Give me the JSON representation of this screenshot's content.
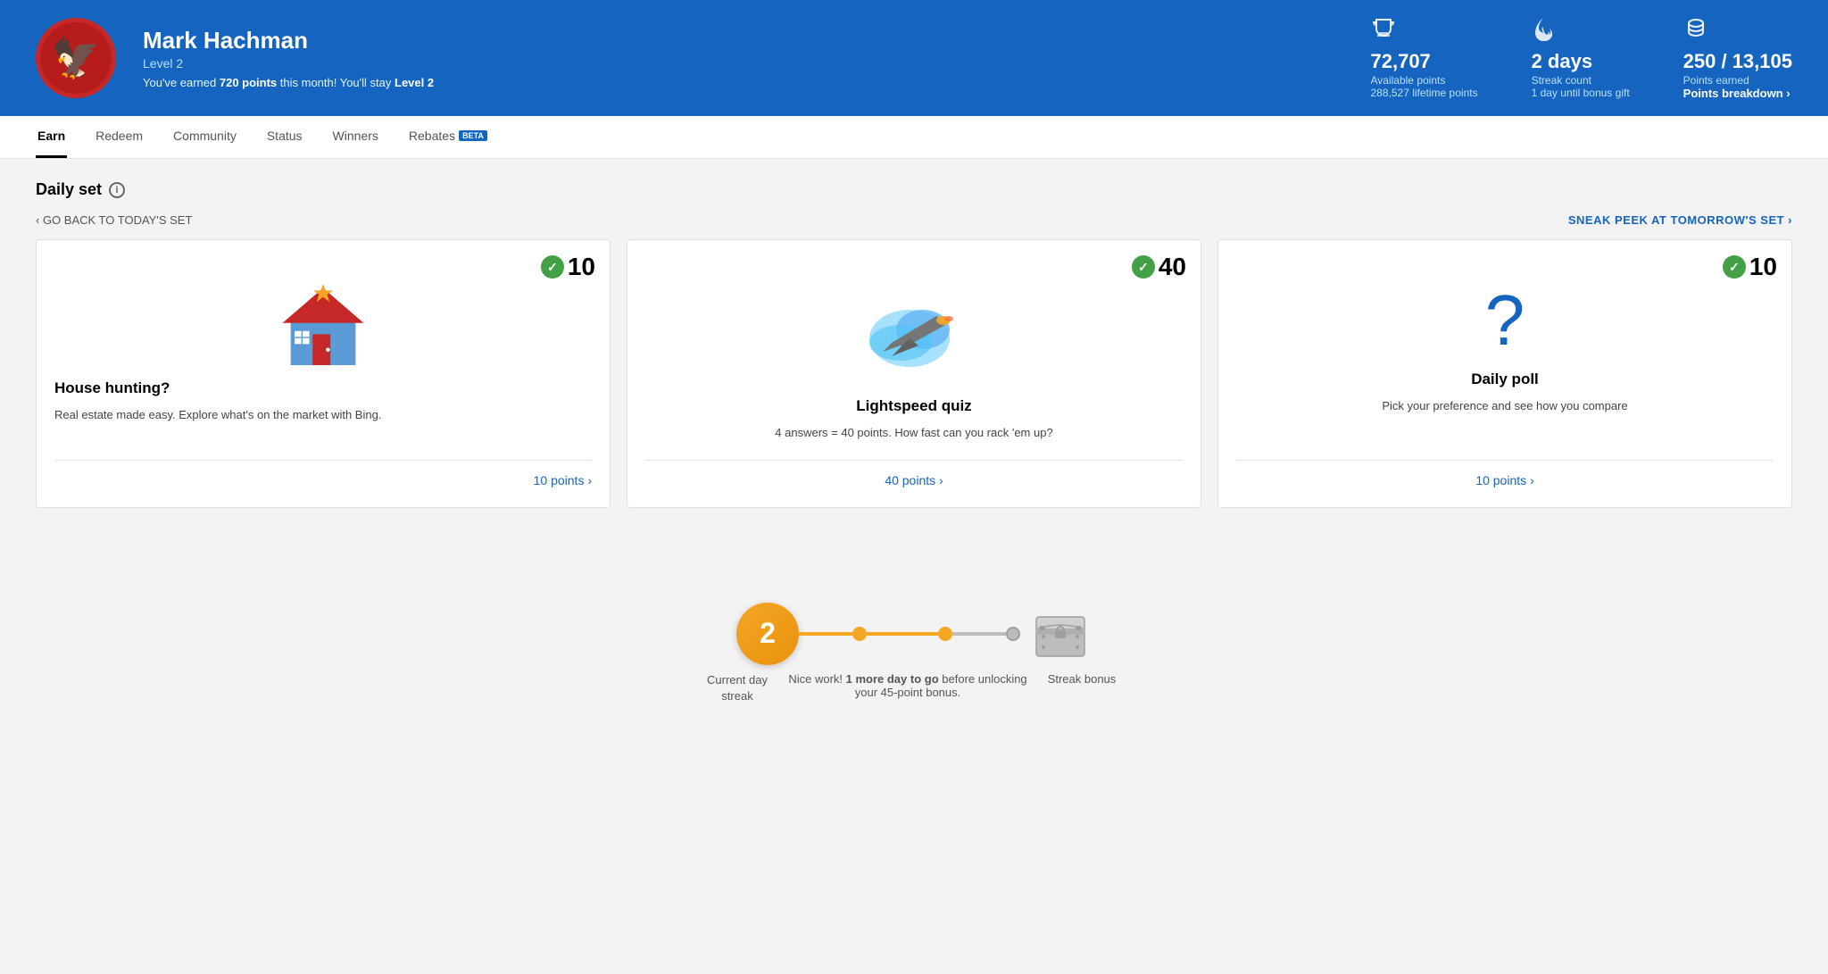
{
  "header": {
    "user_name": "Mark Hachman",
    "user_level": "Level 2",
    "user_msg_prefix": "You've earned ",
    "user_msg_points": "720 points",
    "user_msg_suffix": " this month! You'll stay ",
    "user_msg_level": "Level 2",
    "stats": [
      {
        "id": "available-points",
        "icon": "🏆",
        "main": "72,707",
        "label": "Available points",
        "sub": "288,527 lifetime points"
      },
      {
        "id": "streak",
        "icon": "🔥",
        "main": "2 days",
        "label": "Streak count",
        "sub": "1 day until bonus gift"
      },
      {
        "id": "points-earned",
        "icon": "💰",
        "main": "250 / 13,105",
        "label": "Points earned",
        "link": "Points breakdown ›"
      }
    ]
  },
  "nav": {
    "items": [
      {
        "id": "earn",
        "label": "Earn",
        "active": true
      },
      {
        "id": "redeem",
        "label": "Redeem",
        "active": false
      },
      {
        "id": "community",
        "label": "Community",
        "active": false
      },
      {
        "id": "status",
        "label": "Status",
        "active": false
      },
      {
        "id": "winners",
        "label": "Winners",
        "active": false
      },
      {
        "id": "rebates",
        "label": "Rebates",
        "active": false,
        "badge": "BETA"
      }
    ]
  },
  "main": {
    "section_title": "Daily set",
    "back_label": "‹ GO BACK TO TODAY'S SET",
    "forward_label": "SNEAK PEEK AT TOMORROW'S SET ›",
    "cards": [
      {
        "id": "house-hunting",
        "score": "10",
        "completed": true,
        "title": "House hunting?",
        "desc": "Real estate made easy. Explore what's on the market with Bing.",
        "link": "10 points ›",
        "type": "house"
      },
      {
        "id": "lightspeed-quiz",
        "score": "40",
        "completed": true,
        "title": "Lightspeed quiz",
        "desc": "4 answers = 40 points. How fast can you rack 'em up?",
        "link": "40 points ›",
        "type": "jet"
      },
      {
        "id": "daily-poll",
        "score": "10",
        "completed": true,
        "title": "Daily poll",
        "desc": "Pick your preference and see how you compare",
        "link": "10 points ›",
        "type": "poll"
      }
    ],
    "streak": {
      "day_count": "2",
      "day_label": "Current day streak",
      "middle_label_prefix": "Nice work! ",
      "middle_label_bold": "1 more day to go",
      "middle_label_suffix": " before unlocking your 45-point bonus.",
      "bonus_label": "Streak bonus"
    }
  }
}
